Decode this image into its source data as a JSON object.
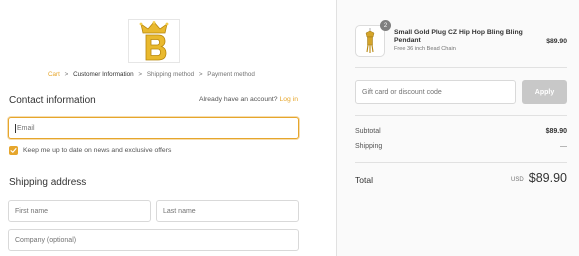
{
  "breadcrumb": {
    "cart": "Cart",
    "customer_information": "Customer Information",
    "shipping_method": "Shipping method",
    "payment_method": "Payment method",
    "separator": ">"
  },
  "contact": {
    "title": "Contact information",
    "account_prompt": "Already have an account?",
    "login_link": "Log in",
    "email_placeholder": "Email",
    "newsletter_label": "Keep me up to date on news and exclusive offers",
    "newsletter_checked": true
  },
  "shipping": {
    "title": "Shipping address",
    "first_name_placeholder": "First name",
    "last_name_placeholder": "Last name",
    "company_placeholder": "Company (optional)"
  },
  "order": {
    "product": {
      "name": "Small Gold Plug CZ Hip Hop Bling Bling Pendant",
      "variant": "Free 36 inch Bead Chain",
      "price": "$89.90",
      "quantity": "2"
    },
    "discount": {
      "placeholder": "Gift card or discount code",
      "apply_label": "Apply"
    },
    "subtotal_label": "Subtotal",
    "subtotal_value": "$89.90",
    "shipping_label": "Shipping",
    "shipping_value": "—",
    "total_label": "Total",
    "total_currency": "USD",
    "total_value": "$89.90"
  },
  "icons": {
    "logo": "crown-b-logo-icon",
    "checkbox": "check-icon",
    "product": "pendant-icon"
  },
  "colors": {
    "accent": "#e6a62c",
    "apply_button": "#c8c8c8",
    "summary_background": "#fafafa"
  }
}
